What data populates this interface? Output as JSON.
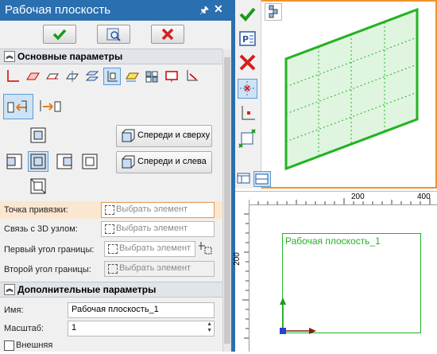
{
  "panel": {
    "title": "Рабочая плоскость",
    "pin_icon": "pin-icon",
    "close_glyph": "x",
    "actions": {
      "ok_icon": "checkmark-icon",
      "preview_icon": "preview-icon",
      "cancel_icon": "cross-icon"
    },
    "section_main": "Основные параметры",
    "section_extra": "Дополнительные параметры",
    "view_buttons": {
      "front_top": "Спереди и сверху",
      "front_left": "Спереди и слева"
    },
    "fields": {
      "anchor_point": {
        "label": "Точка привязки:",
        "placeholder": "Выбрать элемент"
      },
      "link_3d": {
        "label": "Связь с 3D узлом:",
        "placeholder": "Выбрать элемент"
      },
      "first_corner": {
        "label": "Первый угол границы:",
        "placeholder": "Выбрать элемент"
      },
      "second_corner": {
        "label": "Второй угол границы:",
        "placeholder": "Выбрать элемент"
      }
    },
    "name": {
      "label": "Имя:",
      "value": "Рабочая плоскость_1"
    },
    "scale": {
      "label": "Масштаб:",
      "value": "1"
    },
    "external": {
      "label": "Внешняя",
      "checked": false
    }
  },
  "view2d": {
    "ruler_ticks": [
      "200",
      "400"
    ],
    "ruler_v_tick": "200",
    "plane_label": "Рабочая плоскость_1"
  },
  "colors": {
    "accent": "#2a6fb0",
    "plane_green": "#22b322",
    "active_border": "#f0932b"
  }
}
